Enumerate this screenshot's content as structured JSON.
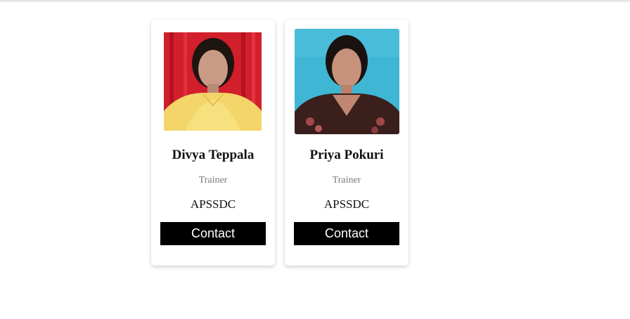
{
  "colors": {
    "button_bg": "#000000",
    "button_text": "#ffffff",
    "role_text": "#7a7a7a"
  },
  "cards": [
    {
      "name": "Divya Teppala",
      "role": "Trainer",
      "organization": "APSSDC",
      "button_label": "Contact",
      "photo_background": "#d11f2c"
    },
    {
      "name": "Priya Pokuri",
      "role": "Trainer",
      "organization": "APSSDC",
      "button_label": "Contact",
      "photo_background": "#3fb6d3"
    }
  ]
}
